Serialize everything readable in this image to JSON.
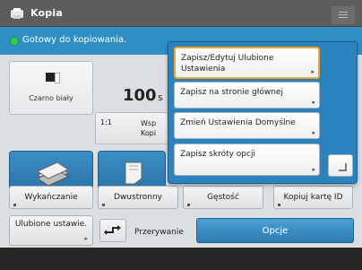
{
  "app": {
    "title": "Kopia"
  },
  "status": {
    "text": "Gotowy do kopiowania."
  },
  "copy_settings": {
    "color_mode": "Czarno biały",
    "copies": "100",
    "copies_suffix": "s",
    "ratio_value": "1:1",
    "ratio_label": "Wsp Kopi"
  },
  "function_buttons": {
    "finishing": "Wykańczanie",
    "duplex": "Dwustronny",
    "density": "Gęstość",
    "id_card": "Kopiuj kartę ID"
  },
  "bottom_row": {
    "favorites": "Ulubione ustawie.",
    "interrupt": "Przerywanie",
    "options": "Opcje"
  },
  "dropdown": {
    "items": [
      {
        "label": "Zapisz/Edytuj Ulubione Ustawienia",
        "selected": true
      },
      {
        "label": "Zapisz na stronie głównej",
        "selected": false
      },
      {
        "label": "Zmień Ustawienia Domyślne",
        "selected": false
      },
      {
        "label": "Zapisz skróty opcji",
        "selected": false
      }
    ]
  },
  "colors": {
    "title_bar": "#5d5d5d",
    "status_bar": "#2f8ec4",
    "status_dot": "#2ecc4a",
    "dropdown_bg": "#2a83bf",
    "highlight": "#f0a524",
    "options_button": "#3a8fc6"
  },
  "icons": {
    "app": "copy-app-icon",
    "menu": "hamburger-menu-icon",
    "color_mode": "black-white-icon",
    "finishing": "paper-stack-icon",
    "duplex": "duplex-page-icon",
    "interrupt": "interrupt-icon",
    "close": "collapse-corner-icon"
  }
}
